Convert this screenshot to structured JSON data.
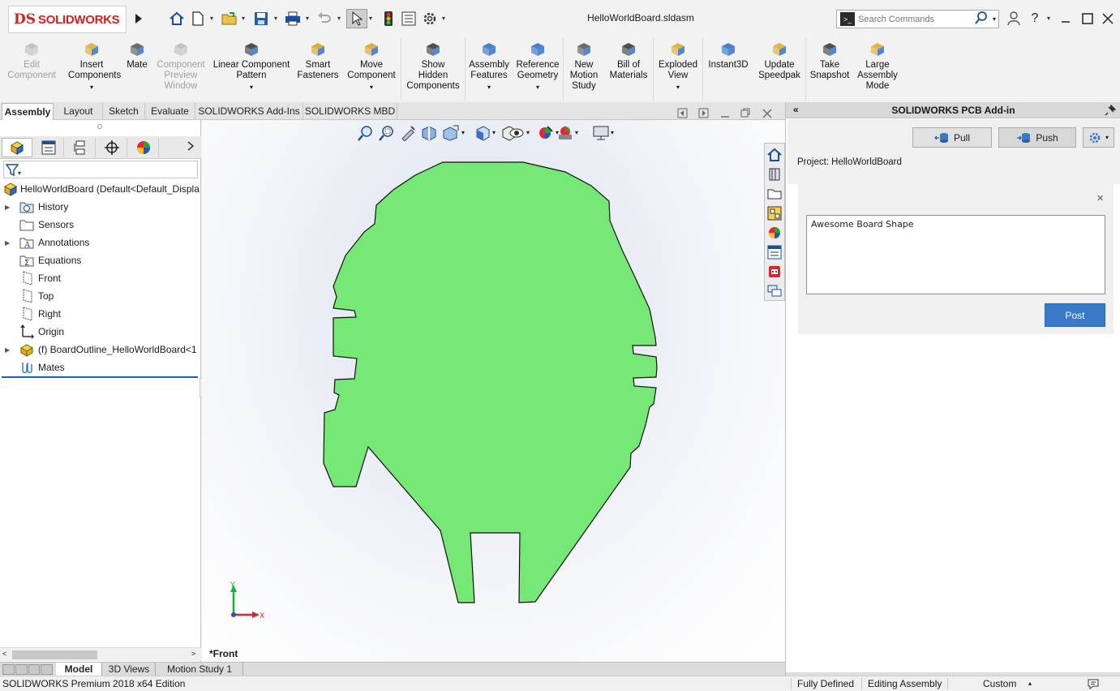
{
  "app": {
    "logo_prefix": "DS",
    "logo_name": "SOLIDWORKS",
    "document_title": "HelloWorldBoard.sldasm",
    "search_placeholder": "Search Commands"
  },
  "ribbon": [
    {
      "id": "edit-component",
      "label": "Edit Component",
      "lines": [
        "Edit",
        "Component"
      ],
      "disabled": true,
      "icon": "edit-component-icon"
    },
    {
      "id": "insert-components",
      "lines": [
        "Insert",
        "Components"
      ],
      "dropdown": true,
      "icon": "insert-components-icon"
    },
    {
      "id": "mate",
      "lines": [
        "Mate"
      ],
      "icon": "mate-icon"
    },
    {
      "id": "component-preview-window",
      "lines": [
        "Component",
        "Preview",
        "Window"
      ],
      "disabled": true,
      "icon": "preview-window-icon"
    },
    {
      "id": "linear-component-pattern",
      "lines": [
        "Linear Component",
        "Pattern"
      ],
      "dropdown": true,
      "icon": "linear-pattern-icon"
    },
    {
      "id": "smart-fasteners",
      "lines": [
        "Smart",
        "Fasteners"
      ],
      "icon": "smart-fasteners-icon"
    },
    {
      "id": "move-component",
      "lines": [
        "Move",
        "Component"
      ],
      "dropdown": true,
      "icon": "move-component-icon"
    },
    {
      "id": "show-hidden-components",
      "lines": [
        "Show",
        "Hidden",
        "Components"
      ],
      "icon": "show-hidden-icon"
    },
    {
      "id": "assembly-features",
      "lines": [
        "Assembly",
        "Features"
      ],
      "dropdown": true,
      "icon": "assembly-features-icon"
    },
    {
      "id": "reference-geometry",
      "lines": [
        "Reference",
        "Geometry"
      ],
      "dropdown": true,
      "icon": "reference-geometry-icon"
    },
    {
      "id": "new-motion-study",
      "lines": [
        "New",
        "Motion",
        "Study"
      ],
      "icon": "motion-study-icon"
    },
    {
      "id": "bill-of-materials",
      "lines": [
        "Bill of",
        "Materials"
      ],
      "icon": "bom-icon"
    },
    {
      "id": "exploded-view",
      "lines": [
        "Exploded",
        "View"
      ],
      "dropdown": true,
      "icon": "exploded-view-icon"
    },
    {
      "id": "instant3d",
      "lines": [
        "Instant3D"
      ],
      "icon": "instant3d-icon"
    },
    {
      "id": "update-speedpak",
      "lines": [
        "Update",
        "Speedpak"
      ],
      "icon": "speedpak-icon"
    },
    {
      "id": "take-snapshot",
      "lines": [
        "Take",
        "Snapshot"
      ],
      "icon": "camera-icon"
    },
    {
      "id": "large-assembly-mode",
      "lines": [
        "Large",
        "Assembly",
        "Mode"
      ],
      "icon": "large-assembly-icon"
    }
  ],
  "command_tabs": [
    "Assembly",
    "Layout",
    "Sketch",
    "Evaluate",
    "SOLIDWORKS Add-Ins",
    "SOLIDWORKS MBD"
  ],
  "feature_tree": {
    "root": "HelloWorldBoard  (Default<Default_Displa",
    "items": [
      {
        "label": "History",
        "expandable": true,
        "icon": "history-folder-icon"
      },
      {
        "label": "Sensors",
        "expandable": false,
        "icon": "sensors-folder-icon"
      },
      {
        "label": "Annotations",
        "expandable": true,
        "icon": "annotations-icon"
      },
      {
        "label": "Equations",
        "expandable": false,
        "icon": "equations-icon"
      },
      {
        "label": "Front",
        "expandable": false,
        "icon": "plane-icon"
      },
      {
        "label": "Top",
        "expandable": false,
        "icon": "plane-icon"
      },
      {
        "label": "Right",
        "expandable": false,
        "icon": "plane-icon"
      },
      {
        "label": "Origin",
        "expandable": false,
        "icon": "origin-icon"
      },
      {
        "label": "(f) BoardOutline_HelloWorldBoard<1",
        "expandable": true,
        "icon": "part-icon"
      },
      {
        "label": "Mates",
        "expandable": false,
        "icon": "mates-icon"
      }
    ]
  },
  "viewport": {
    "view_label": "*Front",
    "axis_x": "X",
    "axis_y": "Y",
    "board_color": "#76e876"
  },
  "bottom_tabs": [
    "Model",
    "3D Views",
    "Motion Study 1"
  ],
  "status_bar": {
    "edition": "SOLIDWORKS Premium 2018 x64 Edition",
    "state": "Fully Defined",
    "mode": "Editing Assembly",
    "units": "Custom"
  },
  "taskpane": {
    "title": "SOLIDWORKS PCB Add-in",
    "pull_label": "Pull",
    "push_label": "Push",
    "project_label": "Project: HelloWorldBoard",
    "post_text": "Awesome Board Shape",
    "post_label": "Post",
    "accent": "#3a78c8"
  }
}
